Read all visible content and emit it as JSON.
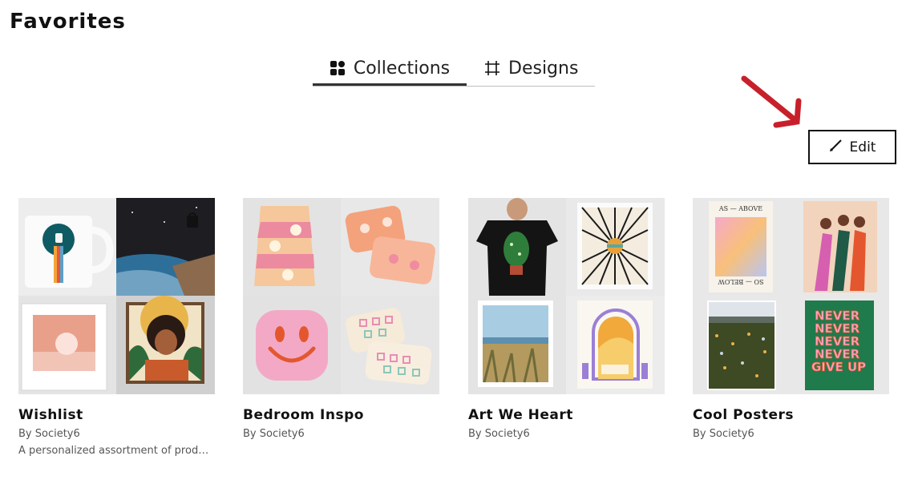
{
  "page": {
    "title": "Favorites"
  },
  "tabs": [
    {
      "label": "Collections",
      "icon": "grid-icon",
      "active": true
    },
    {
      "label": "Designs",
      "icon": "crop-icon",
      "active": false
    }
  ],
  "toolbar": {
    "edit_label": "Edit",
    "edit_icon": "pencil-icon"
  },
  "colors": {
    "annotation_arrow": "#c8202a",
    "tab_underline": "#333333"
  },
  "collections": [
    {
      "title": "Wishlist",
      "by": "By Society6",
      "description": "A personalized assortment of product...",
      "lock_icon": true,
      "items": [
        "astronaut-mug",
        "astronaut-earth-print",
        "pink-room-framed-print",
        "woman-sunglasses-framed-print"
      ]
    },
    {
      "title": "Bedroom Inspo",
      "by": "By Society6",
      "items": [
        "floral-duvet",
        "pattern-pillows",
        "smiley-pillow",
        "checkered-pillows"
      ]
    },
    {
      "title": "Art We Heart",
      "by": "By Society6",
      "items": [
        "plant-tshirt",
        "op-art-print",
        "beach-framed-print",
        "arch-window-print"
      ]
    },
    {
      "title": "Cool Posters",
      "by": "By Society6",
      "poster_text": {
        "top": "AS — ABOVE",
        "bottom": "SO — BELOW"
      },
      "slogan_lines": [
        "NEVER",
        "NEVER",
        "NEVER",
        "NEVER",
        "GIVE UP"
      ],
      "items": [
        "gradient-poster",
        "dancing-women-poster",
        "flower-field-poster",
        "never-give-up-poster"
      ]
    }
  ]
}
